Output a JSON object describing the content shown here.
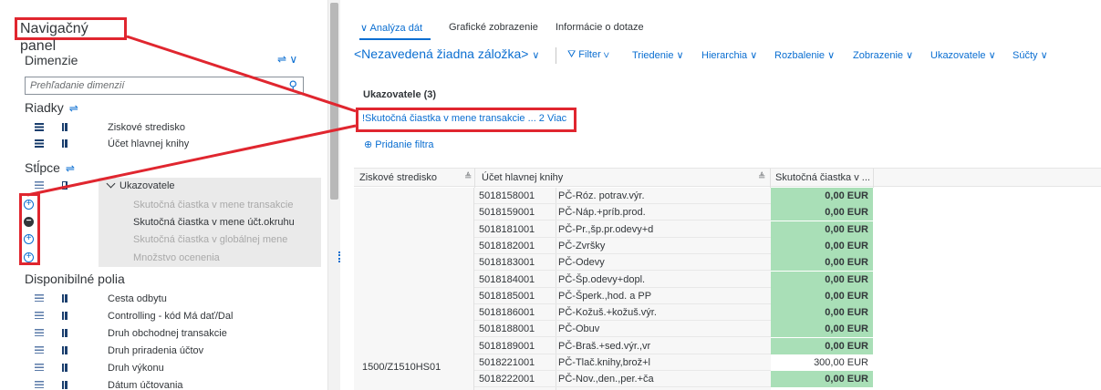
{
  "nav": {
    "title": "Navigačný panel",
    "dimensions_label": "Dimenzie",
    "dimensions_tools": "⇌ ∨",
    "search_placeholder": "Prehľadanie dimenzií",
    "rows_label": "Riadky",
    "rows_items": [
      "Ziskové stredisko",
      "Účet hlavnej knihy"
    ],
    "columns_label": "Stĺpce",
    "indicators_label": "Ukazovatele",
    "indicator_items": [
      {
        "label": "Skutočná čiastka v mene transakcie",
        "active": false
      },
      {
        "label": "Skutočná čiastka v mene účt.okruhu",
        "active": true
      },
      {
        "label": "Skutočná čiastka v globálnej mene",
        "active": false
      },
      {
        "label": "Množstvo ocenenia",
        "active": false
      }
    ],
    "available_label": "Disponibilné polia",
    "available_items": [
      "Cesta odbytu",
      "Controlling - kód Má dať/Dal",
      "Druh obchodnej transakcie",
      "Druh priradenia účtov",
      "Druh výkonu",
      "Dátum účtovania"
    ]
  },
  "tabs": [
    {
      "label": "Analýza dát",
      "active": true
    },
    {
      "label": "Grafické zobrazenie",
      "active": false
    },
    {
      "label": "Informácie o dotaze",
      "active": false
    }
  ],
  "toolbar": {
    "bookmark": "<Nezavedená žiadna záložka>",
    "items": [
      "Filter",
      "Triedenie",
      "Hierarchia",
      "Rozbalenie",
      "Zobrazenie",
      "Ukazovatele",
      "Súčty"
    ]
  },
  "filters": {
    "title": "Ukazovatele (3)",
    "link": "!Skutočná čiastka v mene transakcie ... 2 Viac",
    "add": "Pridanie filtra"
  },
  "table": {
    "headers": [
      "Ziskové stredisko",
      "Účet hlavnej knihy",
      "Skutočná čiastka v ..."
    ],
    "group": "1500/Z1510HS01",
    "rows": [
      [
        "5018158001",
        "PČ-Róz. potrav.výr.",
        "0,00 EUR"
      ],
      [
        "5018159001",
        "PČ-Náp.+príb.prod.",
        "0,00 EUR"
      ],
      [
        "5018181001",
        "PČ-Pr.,šp.pr.odevy+d",
        "0,00 EUR"
      ],
      [
        "5018182001",
        "PČ-Zvršky",
        "0,00 EUR"
      ],
      [
        "5018183001",
        "PČ-Odevy",
        "0,00 EUR"
      ],
      [
        "5018184001",
        "PČ-Šp.odevy+dopl.",
        "0,00 EUR"
      ],
      [
        "5018185001",
        "PČ-Šperk.,hod. a PP",
        "0,00 EUR"
      ],
      [
        "5018186001",
        "PČ-Kožuš.+kožuš.výr.",
        "0,00 EUR"
      ],
      [
        "5018188001",
        "PČ-Obuv",
        "0,00 EUR"
      ],
      [
        "5018189001",
        "PČ-Braš.+sed.výr.,vr",
        "0,00 EUR"
      ],
      [
        "5018221001",
        "PČ-Tlač.knihy,brož+l",
        "300,00 EUR"
      ],
      [
        "5018222001",
        "PČ-Nov.,den.,per.+ča",
        "0,00 EUR"
      ]
    ]
  },
  "colors": {
    "accent": "#0a6ed1",
    "highlight": "#e0262f",
    "positive_cell": "#a9dfb7"
  }
}
